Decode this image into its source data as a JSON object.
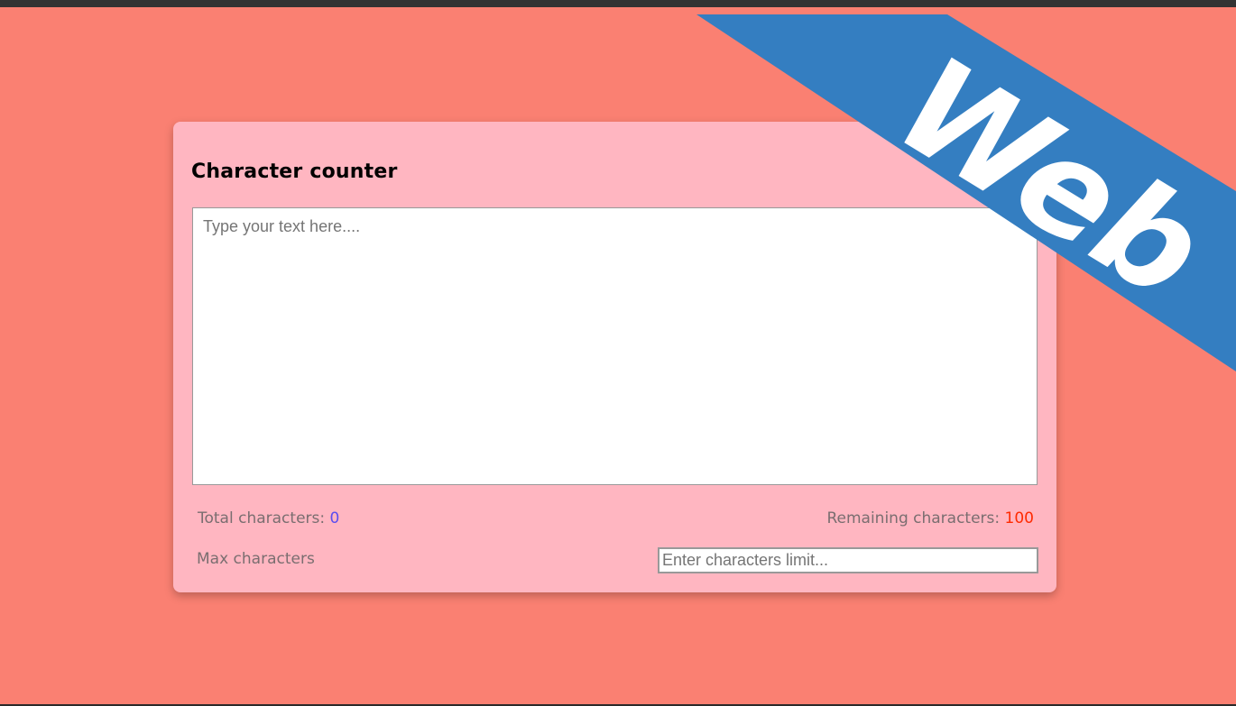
{
  "card": {
    "title": "Character counter",
    "textarea_placeholder": "Type your text here....",
    "textarea_value": "",
    "total_label": "Total characters: ",
    "total_value": "0",
    "remaining_label": "Remaining characters: ",
    "remaining_value": "100",
    "max_label": "Max characters",
    "limit_placeholder": "Enter characters limit...",
    "limit_value": ""
  },
  "ribbon": {
    "text": "Web",
    "color": "#347ec1"
  },
  "colors": {
    "page_background": "#fa8072",
    "card_background": "#ffb6c1",
    "total_value": "#5b4df0",
    "remaining_value": "#ff2a00"
  }
}
